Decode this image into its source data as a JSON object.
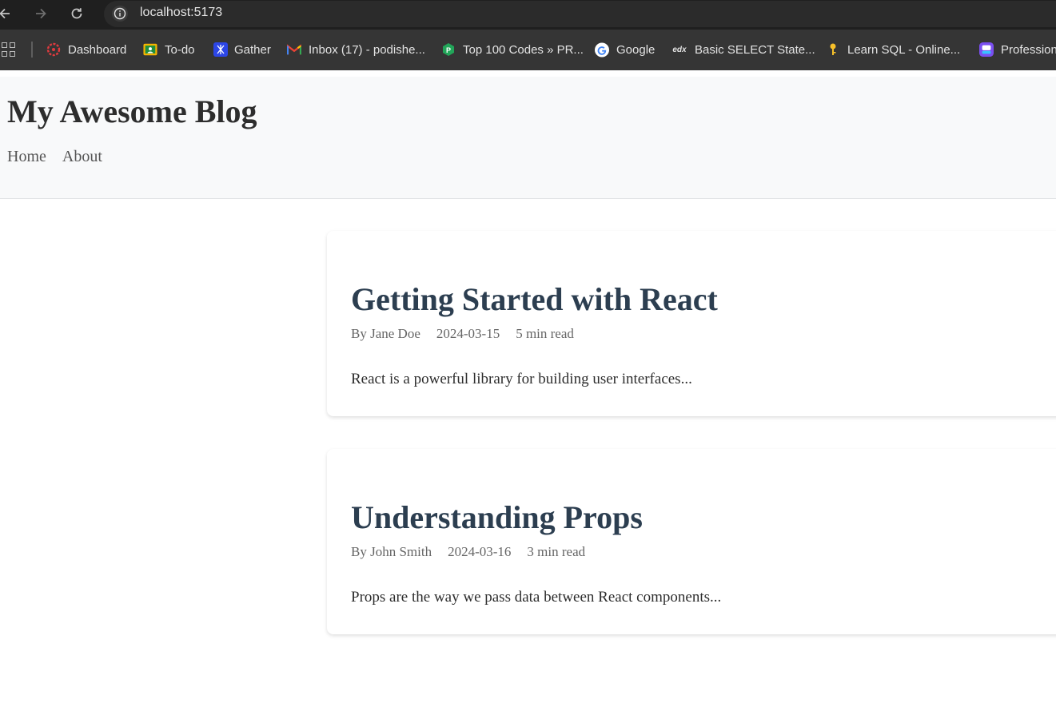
{
  "browser": {
    "url": "localhost:5173",
    "bookmarks": [
      {
        "label": "Dashboard",
        "icon": "canvas-icon"
      },
      {
        "label": "To-do",
        "icon": "google-classroom-icon"
      },
      {
        "label": "Gather",
        "icon": "gather-icon"
      },
      {
        "label": "Inbox (17) - podishe...",
        "icon": "gmail-icon"
      },
      {
        "label": "Top 100 Codes » PR...",
        "icon": "green-hexagon-icon"
      },
      {
        "label": "Google",
        "icon": "google-icon"
      },
      {
        "label": "Basic SELECT State...",
        "icon": "edx-icon"
      },
      {
        "label": "Learn SQL - Online...",
        "icon": "key-icon"
      },
      {
        "label": "Profession",
        "icon": "purple-app-icon"
      }
    ]
  },
  "site": {
    "title": "My Awesome Blog",
    "nav": {
      "home": "Home",
      "about": "About"
    }
  },
  "posts": [
    {
      "title": "Getting Started with React",
      "author": "By Jane Doe",
      "date": "2024-03-15",
      "read_time": "5 min read",
      "excerpt": "React is a powerful library for building user interfaces..."
    },
    {
      "title": "Understanding Props",
      "author": "By John Smith",
      "date": "2024-03-16",
      "read_time": "3 min read",
      "excerpt": "Props are the way we pass data between React components..."
    }
  ],
  "colors": {
    "header_bg": "#f8f9fa",
    "post_title": "#2c3e50",
    "meta_text": "#666666",
    "browser_bar": "#1f1f1f",
    "bookmarks_bar": "#353535"
  }
}
